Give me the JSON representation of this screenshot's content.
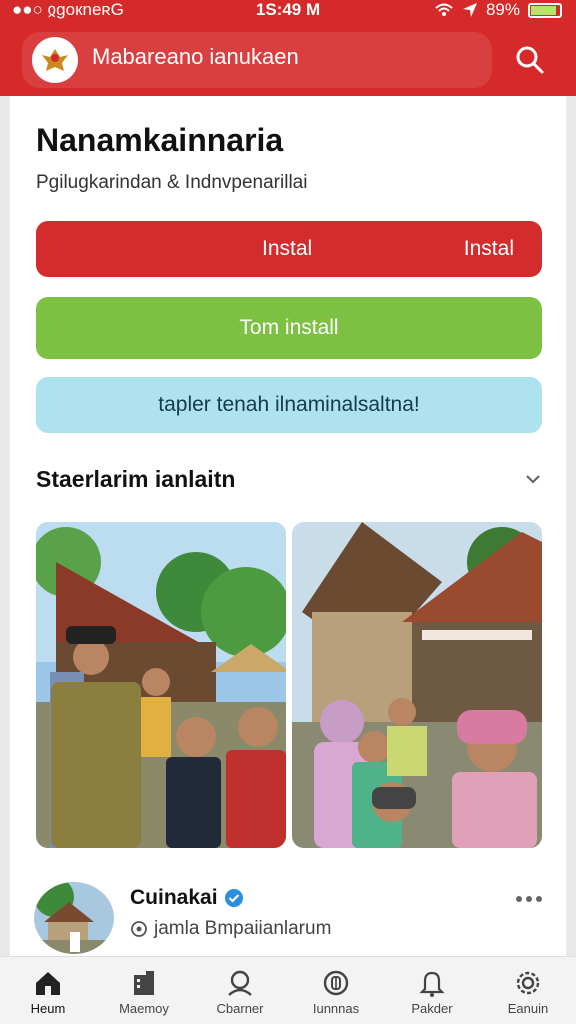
{
  "status_bar": {
    "carrier": "●●○ ჲgoкneʀG",
    "time": "1S:49 M",
    "battery": "89%",
    "battery_level": 0.89
  },
  "app_bar": {
    "title": "Mabareano ianukaen"
  },
  "card": {
    "title": "Nanamkainnaria",
    "subtitle": "Pgilugkarindan & Indnvpenarillai",
    "install_button": {
      "label_center": "Instal",
      "label_right": "Instal"
    },
    "tom_install_button": {
      "label": "Tom install"
    },
    "info_button": {
      "label": "tapler tenah ilnaminalsaltna!"
    }
  },
  "section": {
    "title": "Staerlarim ianlaitn"
  },
  "post": {
    "author": "Cuinakai",
    "location": "jamla Bmpaiianlarum"
  },
  "tabs": [
    {
      "label": "Heum"
    },
    {
      "label": "Maemoy"
    },
    {
      "label": "Cbarner"
    },
    {
      "label": "Iunnnas"
    },
    {
      "label": "Pakder"
    },
    {
      "label": "Eanuin"
    }
  ],
  "colors": {
    "primary_red": "#d62a2a",
    "green": "#7cc142",
    "cyan": "#aee2ef"
  }
}
